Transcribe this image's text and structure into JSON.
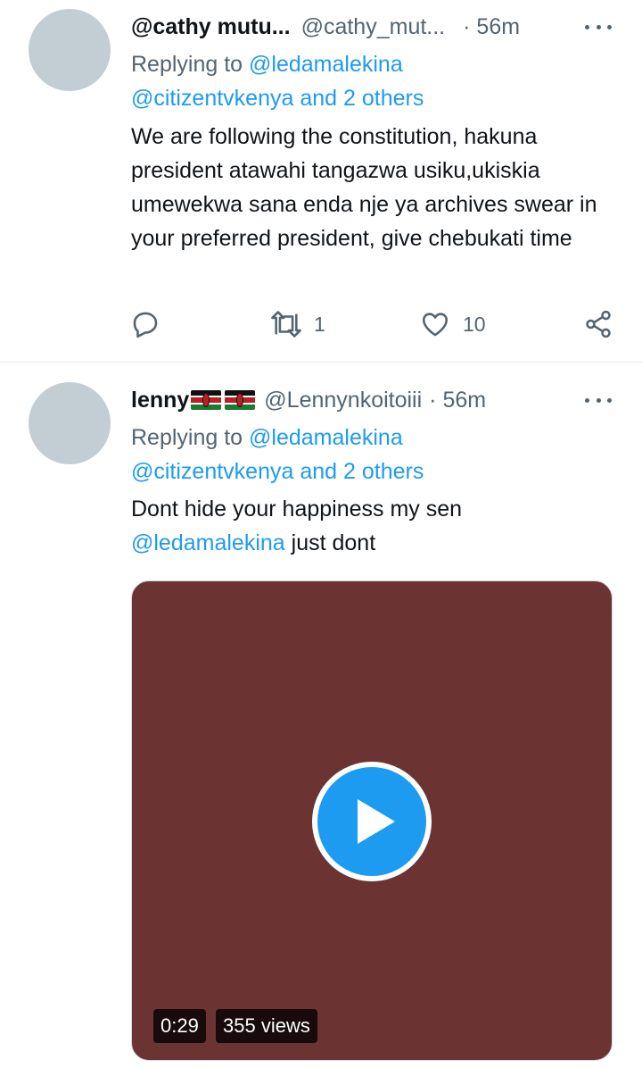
{
  "tweets": [
    {
      "name": "@cathy mutu...",
      "handle": "@cathy_mut...",
      "time": "· 56m",
      "reply_prefix": "Replying to",
      "reply_to_1": "@ledamalekina",
      "reply_to_2": "@citizentvkenya and 2 others",
      "text": "We are following the constitution, hakuna president atawahi tangazwa usiku,ukiskia umewekwa sana enda nje ya archives swear in your preferred president, give chebukati time",
      "retweets": "1",
      "likes": "10"
    },
    {
      "name": "lenny",
      "handle": "@Lennynkoitoiii",
      "time": "· 56m",
      "reply_prefix": "Replying to",
      "reply_to_1": "@ledamalekina",
      "reply_to_2": "@citizentvkenya and 2 others",
      "text_1": "Dont hide your happiness my sen",
      "text_mention": "@ledamalekina",
      "text_2": " just dont",
      "video": {
        "duration": "0:29",
        "views": "355 views",
        "background": "#6b3332"
      }
    }
  ],
  "colors": {
    "link": "#1d9bf0",
    "secondary_text": "#536471",
    "avatar": "#c2cdd4"
  },
  "icons": [
    "reply-icon",
    "retweet-icon",
    "like-icon",
    "share-icon",
    "more-icon",
    "kenya-flag-icon",
    "play-icon"
  ]
}
